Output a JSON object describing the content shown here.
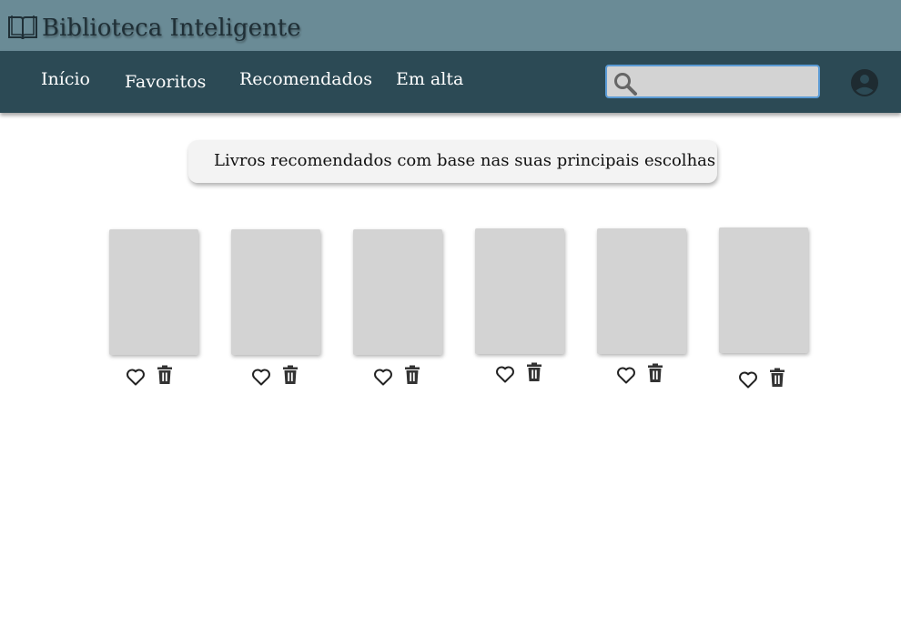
{
  "app": {
    "title": "Biblioteca Inteligente",
    "logo_icon": "open-book-icon"
  },
  "nav": {
    "items": [
      {
        "label": "Início"
      },
      {
        "label": "Favoritos"
      },
      {
        "label": "Recomendados"
      },
      {
        "label": "Em alta"
      }
    ]
  },
  "search": {
    "icon": "search-icon",
    "value": "",
    "placeholder": ""
  },
  "account": {
    "icon": "account-circle-icon"
  },
  "main": {
    "banner_text": "Livros recomendados com base nas suas principais escolhas",
    "books": [
      {
        "favorite_icon": "heart-outline-icon",
        "delete_icon": "trash-icon"
      },
      {
        "favorite_icon": "heart-outline-icon",
        "delete_icon": "trash-icon"
      },
      {
        "favorite_icon": "heart-outline-icon",
        "delete_icon": "trash-icon"
      },
      {
        "favorite_icon": "heart-outline-icon",
        "delete_icon": "trash-icon"
      },
      {
        "favorite_icon": "heart-outline-icon",
        "delete_icon": "trash-icon"
      },
      {
        "favorite_icon": "heart-outline-icon",
        "delete_icon": "trash-icon"
      }
    ]
  },
  "colors": {
    "titlebar": "#6a8b96",
    "navbar": "#2c4a55",
    "search_border": "#5b9bd5",
    "placeholder_cover": "#d3d3d3"
  }
}
